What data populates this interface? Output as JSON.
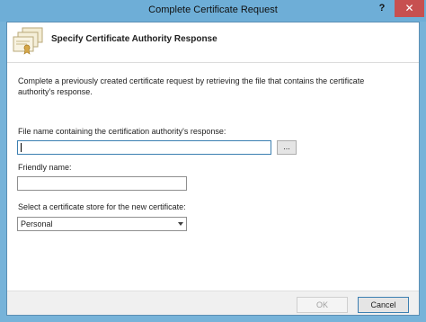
{
  "window": {
    "title": "Complete Certificate Request",
    "help_label": "?",
    "close_label": "✕"
  },
  "header": {
    "title": "Specify Certificate Authority Response",
    "icon": "certificate-stack-icon"
  },
  "main": {
    "description": "Complete a previously created certificate request by retrieving the file that contains the certificate authority's response.",
    "file_label": "File name containing the certification authority's response:",
    "file_value": "",
    "browse_label": "...",
    "friendly_label": "Friendly name:",
    "friendly_value": "",
    "store_label": "Select a certificate store for the new certificate:",
    "store_value": "Personal"
  },
  "footer": {
    "ok_label": "OK",
    "cancel_label": "Cancel"
  }
}
